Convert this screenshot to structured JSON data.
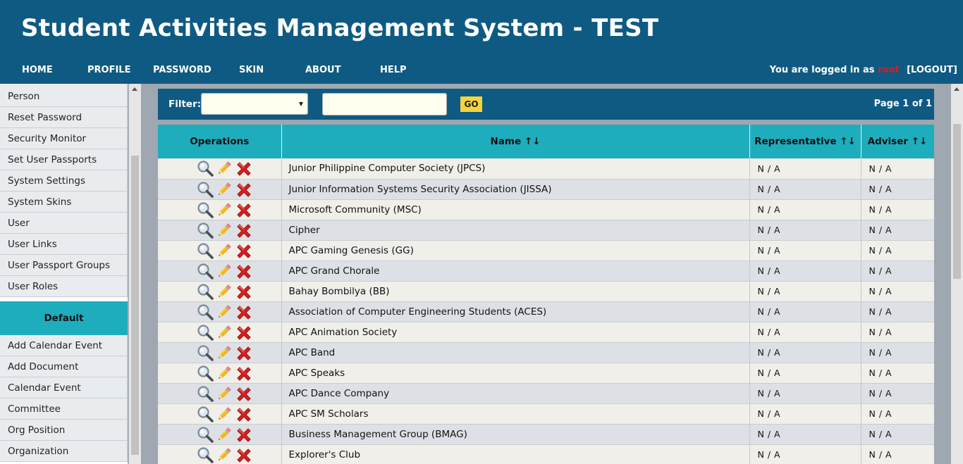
{
  "header": {
    "title": "Student Activities Management System - TEST",
    "nav": [
      {
        "label": "HOME",
        "name": "home"
      },
      {
        "label": "PROFILE",
        "name": "profile"
      },
      {
        "label": "PASSWORD",
        "name": "password"
      },
      {
        "label": "SKIN",
        "name": "skin"
      },
      {
        "label": "ABOUT",
        "name": "about"
      },
      {
        "label": "HELP",
        "name": "help"
      }
    ],
    "login_text": "You are logged in as",
    "login_user": "root",
    "logout_label": "[LOGOUT]"
  },
  "sidebar": {
    "items": [
      "Person",
      "Reset Password",
      "Security Monitor",
      "Set User Passports",
      "System Settings",
      "System Skins",
      "User",
      "User Links",
      "User Passport Groups",
      "User Roles"
    ],
    "section_title": "Default",
    "section_items": [
      "Add Calendar Event",
      "Add Document",
      "Calendar Event",
      "Committee",
      "Org Position",
      "Organization"
    ]
  },
  "filter": {
    "label": "Filter:",
    "select_value": "",
    "input_value": "",
    "go_label": "GO",
    "page_info": "Page 1 of 1"
  },
  "table": {
    "headers": {
      "operations": "Operations",
      "name": "Name ↑↓",
      "representative": "Representative ↑↓",
      "adviser": "Adviser ↑↓"
    },
    "rows": [
      {
        "name": "Junior Philippine Computer Society (JPCS)",
        "representative": "N / A",
        "adviser": "N / A"
      },
      {
        "name": "Junior Information Systems Security Association (JISSA)",
        "representative": "N / A",
        "adviser": "N / A"
      },
      {
        "name": "Microsoft Community (MSC)",
        "representative": "N / A",
        "adviser": "N / A"
      },
      {
        "name": "Cipher",
        "representative": "N / A",
        "adviser": "N / A"
      },
      {
        "name": "APC Gaming Genesis (GG)",
        "representative": "N / A",
        "adviser": "N / A"
      },
      {
        "name": "APC Grand Chorale",
        "representative": "N / A",
        "adviser": "N / A"
      },
      {
        "name": "Bahay Bombilya (BB)",
        "representative": "N / A",
        "adviser": "N / A"
      },
      {
        "name": "Association of Computer Engineering Students (ACES)",
        "representative": "N / A",
        "adviser": "N / A"
      },
      {
        "name": "APC Animation Society",
        "representative": "N / A",
        "adviser": "N / A"
      },
      {
        "name": "APC Band",
        "representative": "N / A",
        "adviser": "N / A"
      },
      {
        "name": "APC Speaks",
        "representative": "N / A",
        "adviser": "N / A"
      },
      {
        "name": "APC Dance Company",
        "representative": "N / A",
        "adviser": "N / A"
      },
      {
        "name": "APC SM Scholars",
        "representative": "N / A",
        "adviser": "N / A"
      },
      {
        "name": "Business Management Group (BMAG)",
        "representative": "N / A",
        "adviser": "N / A"
      },
      {
        "name": "Explorer's Club",
        "representative": "N / A",
        "adviser": "N / A"
      }
    ],
    "operation_icons": [
      "magnifier-icon",
      "pencil-icon",
      "delete-x-icon"
    ]
  },
  "colors": {
    "header_bg": "#0f5a82",
    "accent_teal": "#1eadbd",
    "go_yellow": "#f3d43c",
    "delete_red": "#d82020",
    "login_user": "#d42020"
  }
}
